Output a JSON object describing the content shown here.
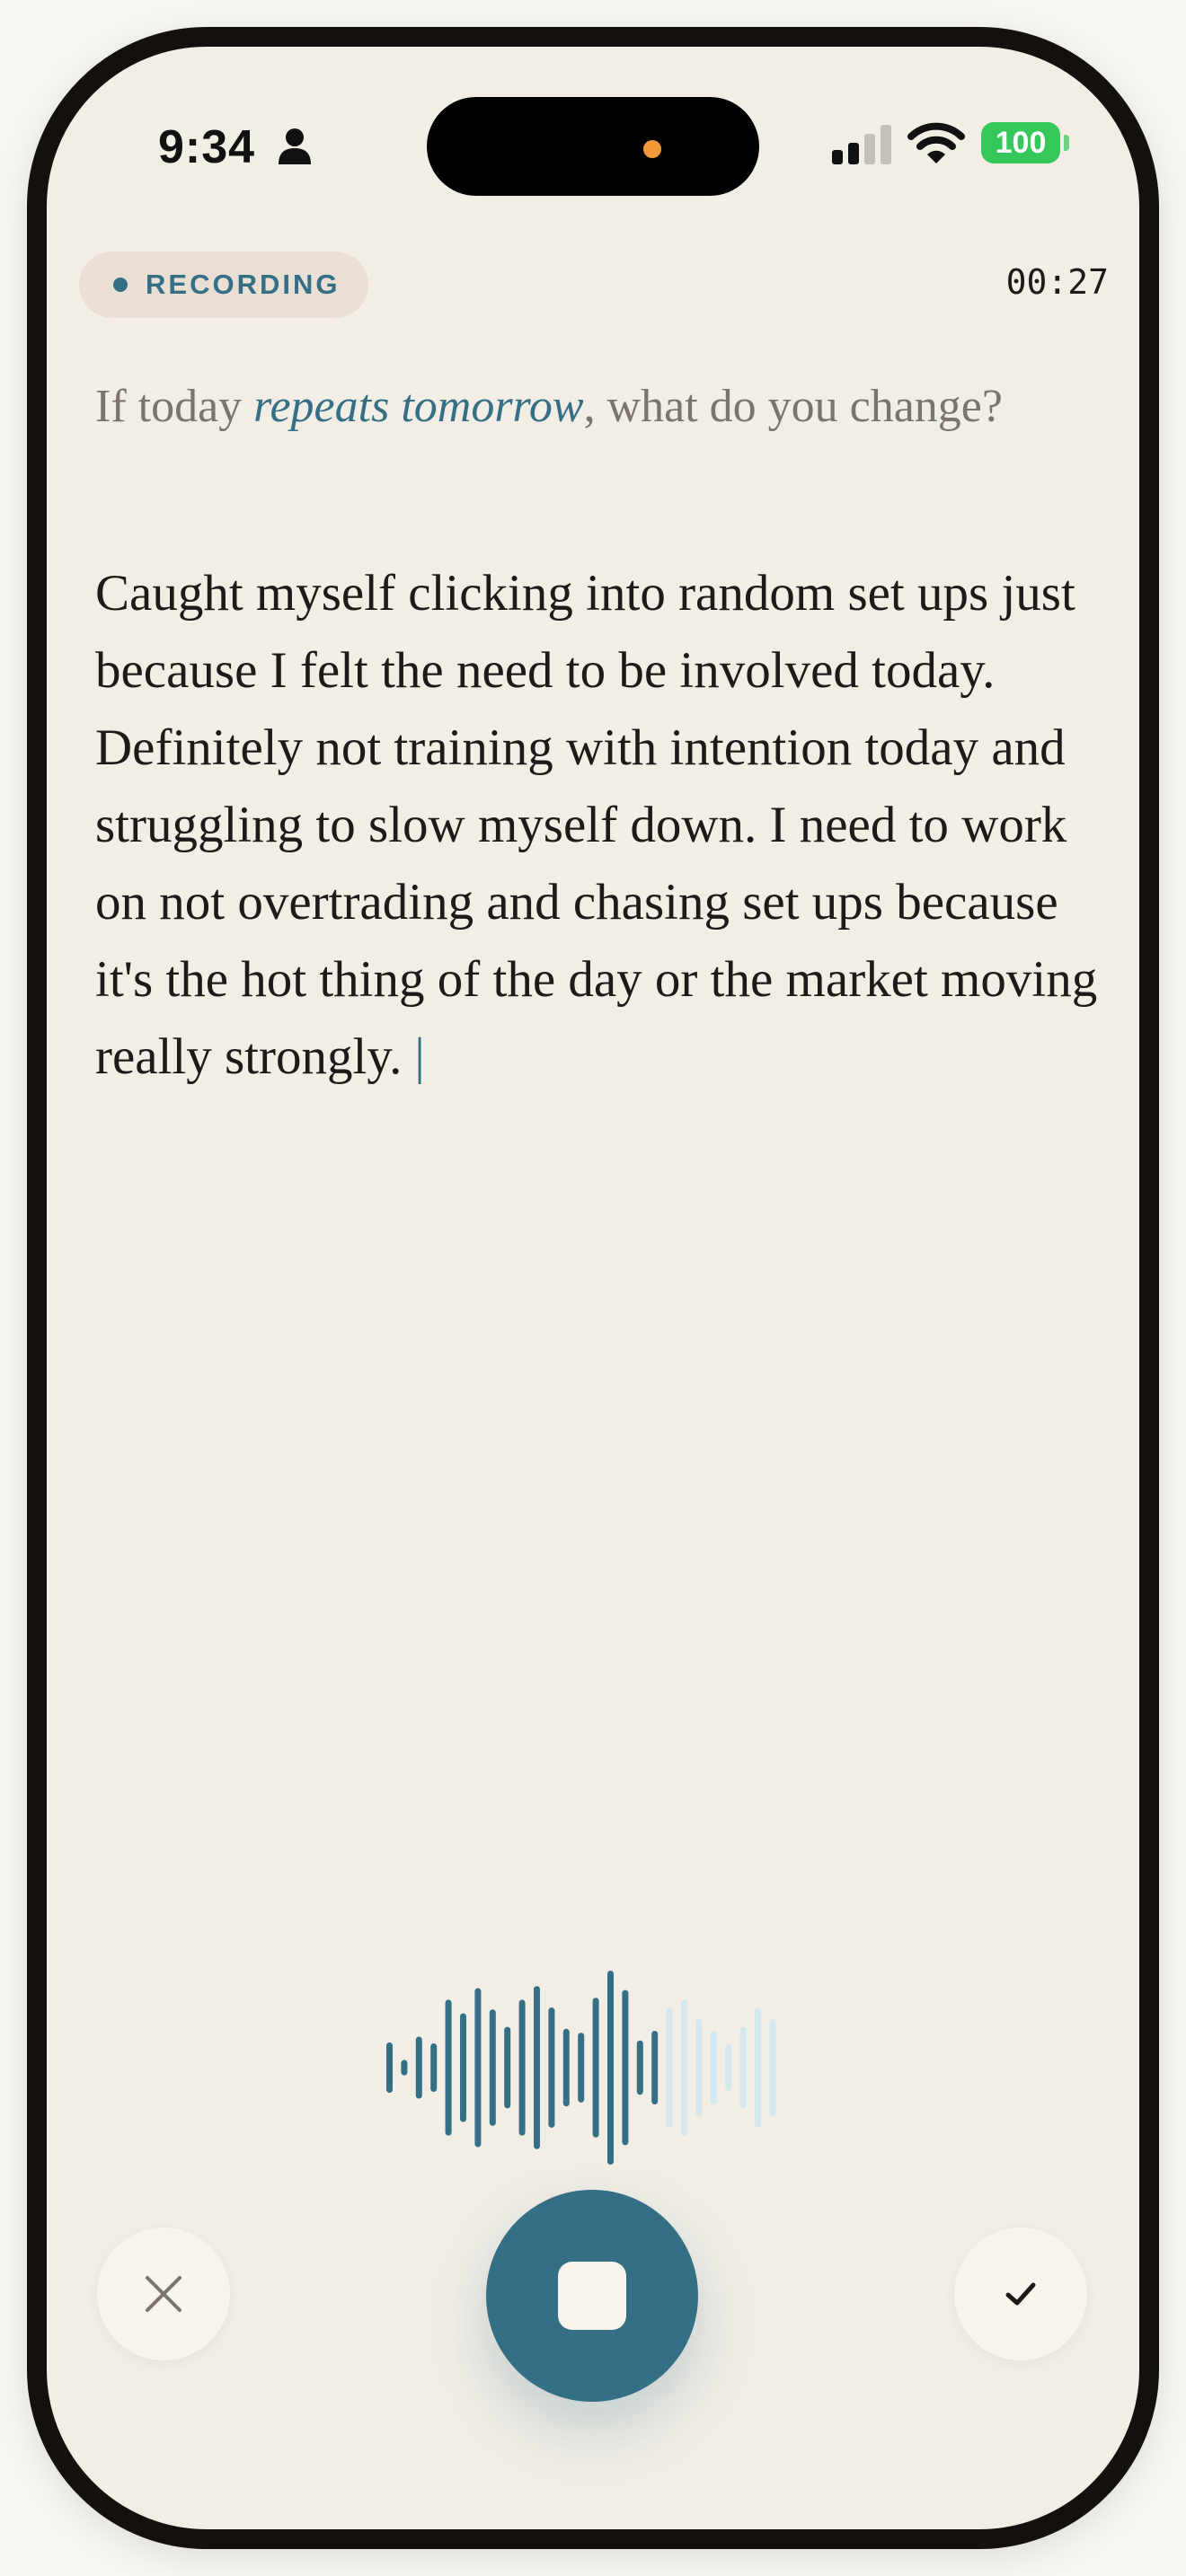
{
  "status_bar": {
    "time": "9:34",
    "battery": "100",
    "icons": [
      "person-icon",
      "cellular-signal-icon",
      "wifi-icon",
      "battery-icon"
    ]
  },
  "recording": {
    "badge_label": "RECORDING",
    "elapsed": "00:27"
  },
  "prompt": {
    "before": "If today ",
    "emphasis": "repeats tomorrow",
    "after": ", what do you change?"
  },
  "transcript": {
    "text": "Caught myself clicking into random set ups just because I felt the need to be involved today. Definitely not training with intention today and struggling to slow myself down. I need to work on not overtrading and chasing set ups because it's the hot thing of the day or the market moving really strongly.",
    "caret": "|"
  },
  "controls": {
    "cancel_icon": "close-icon",
    "stop_icon": "stop-icon",
    "confirm_icon": "checkmark-icon"
  },
  "waveform": {
    "bar_levels": [
      0.26,
      0.08,
      0.32,
      0.25,
      0.7,
      0.56,
      0.82,
      0.6,
      0.42,
      0.7,
      0.84,
      0.62,
      0.4,
      0.36,
      0.72,
      1.0,
      0.8,
      0.28,
      0.38,
      0.62,
      0.7,
      0.5,
      0.38,
      0.24,
      0.42,
      0.62,
      0.5
    ],
    "active_bars": 19,
    "colors": {
      "active": "#356f86",
      "inactive": "#d4e6ee",
      "background": "#f2eee6"
    }
  }
}
